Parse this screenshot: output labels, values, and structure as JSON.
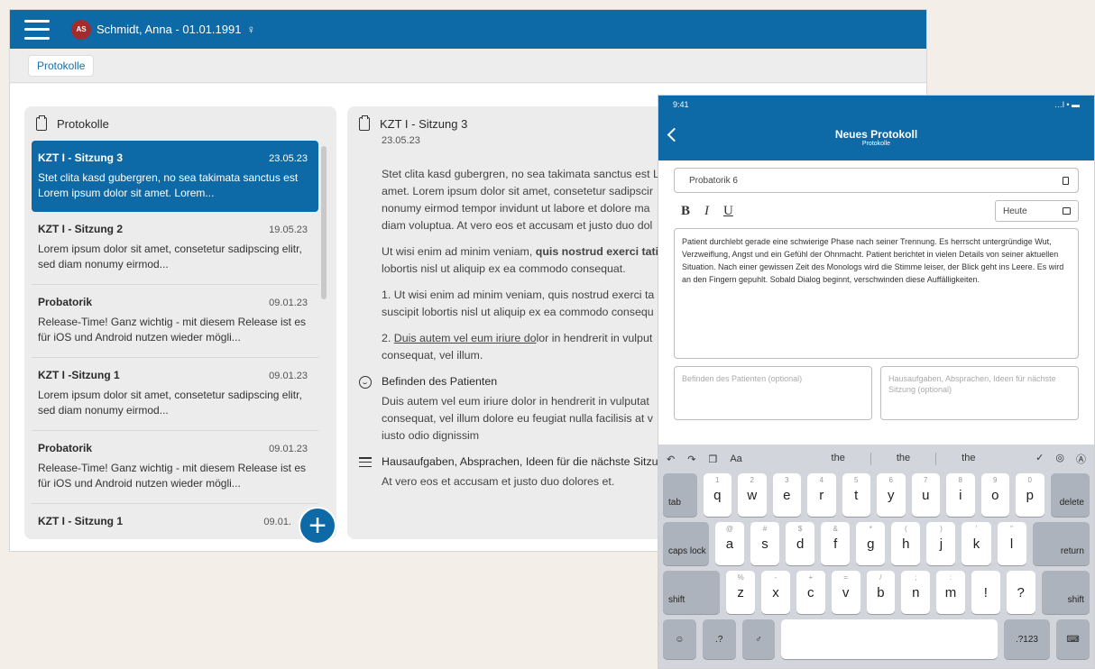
{
  "header": {
    "avatar_initials": "AS",
    "patient": "Schmidt, Anna - 01.01.1991",
    "gender_symbol": "♀"
  },
  "breadcrumb": {
    "chip": "Protokolle"
  },
  "list_panel": {
    "title": "Protokolle",
    "items": [
      {
        "title": "KZT I - Sitzung 3",
        "date": "23.05.23",
        "text": "Stet clita kasd gubergren, no sea takimata sanctus est Lorem ipsum dolor sit amet. Lorem...",
        "active": true
      },
      {
        "title": "KZT I - Sitzung 2",
        "date": "19.05.23",
        "text": "Lorem ipsum dolor sit amet, consetetur sadipscing elitr, sed diam nonumy eirmod..."
      },
      {
        "title": "Probatorik",
        "date": "09.01.23",
        "text": "Release-Time! Ganz wichtig - mit diesem Release ist es für iOS und Android nutzen wieder mögli..."
      },
      {
        "title": "KZT I -Sitzung 1",
        "date": "09.01.23",
        "text": "Lorem ipsum dolor sit amet, consetetur sadipscing elitr, sed diam nonumy eirmod..."
      },
      {
        "title": "Probatorik",
        "date": "09.01.23",
        "text": "Release-Time! Ganz wichtig - mit diesem Release ist es für iOS und Android nutzen wieder mögli..."
      },
      {
        "title": "KZT I - Sitzung 1",
        "date": "09.01.",
        "text": ""
      }
    ],
    "fab_label": "+"
  },
  "detail": {
    "title": "KZT I - Sitzung 3",
    "date": "23.05.23",
    "para1": [
      "Stet clita kasd gubergren, no sea takimata sanctus est L",
      "amet. Lorem ipsum dolor sit amet, consetetur sadipscir",
      "nonumy eirmod tempor invidunt ut labore et dolore ma",
      "diam voluptua. At vero eos et accusam et justo duo dol"
    ],
    "para2_a": "Ut wisi enim ad minim veniam, ",
    "para2_bold": "quis nostrud exerci tatio",
    "para2_b": "lobortis nisl ut aliquip ex ea commodo consequat.",
    "para3": [
      "1. Ut wisi enim ad minim veniam, quis nostrud exerci ta",
      "suscipit lobortis nisl ut aliquip ex ea commodo consequ"
    ],
    "para4_prefix": "2. ",
    "para4_link": "Duis autem vel eum iriure do",
    "para4_a": "lor in hendrerit in vulput",
    "para4_b": "consequat, vel illum.",
    "section1_title": "Befinden des Patienten",
    "section1_text": [
      "Duis autem vel eum iriure dolor in hendrerit in vulputat",
      "consequat, vel illum dolore eu feugiat nulla facilisis at v",
      "iusto odio dignissim"
    ],
    "section2_title": "Hausaufgaben, Absprachen, Ideen für die nächste Sitzu",
    "section2_text": "At vero eos et accusam et justo duo dolores et."
  },
  "tablet": {
    "time": "9:41",
    "status_icons": "…l • ▬",
    "nav_title": "Neues Protokoll",
    "nav_subtitle": "Protokolle",
    "title_input": "Probatorik 6",
    "fmt_bold": "B",
    "fmt_italic": "I",
    "fmt_underline": "U",
    "date_select": "Heute",
    "note": "Patient durchlebt gerade eine schwierige Phase nach seiner Trennung. Es herrscht untergründige Wut, Verzweiflung, Angst und ein Gefühl der Ohnmacht. Patient berichtet in vielen Details von seiner aktuellen Situation. Nach einer gewissen Zeit des Monologs wird die Stimme leiser, der Blick geht ins Leere. Es wird an den Fingern gepuhlt. Sobald Dialog beginnt, verschwinden diese Auffälligkeiten.",
    "field_condition_placeholder": "Befinden des Patienten (optional)",
    "field_homework_placeholder": "Hausaufgaben, Absprachen, Ideen für nächste Sitzung (optional)"
  },
  "keyboard": {
    "predict_left": [
      "↶",
      "↷",
      "❐",
      "Aa"
    ],
    "predictions": [
      "the",
      "the",
      "the"
    ],
    "predict_right": [
      "✓",
      "◎",
      "Ⓐ"
    ],
    "row1": [
      [
        "q",
        "1"
      ],
      [
        "w",
        "2"
      ],
      [
        "e",
        "3"
      ],
      [
        "r",
        "4"
      ],
      [
        "t",
        "5"
      ],
      [
        "y",
        "6"
      ],
      [
        "u",
        "7"
      ],
      [
        "i",
        "8"
      ],
      [
        "o",
        "9"
      ],
      [
        "p",
        "0"
      ]
    ],
    "row2": [
      [
        "a",
        "@"
      ],
      [
        "s",
        "#"
      ],
      [
        "d",
        "$"
      ],
      [
        "f",
        "&"
      ],
      [
        "g",
        "*"
      ],
      [
        "h",
        "("
      ],
      [
        "j",
        ")"
      ],
      [
        "k",
        "'"
      ],
      [
        "l",
        "\""
      ]
    ],
    "row3": [
      [
        "z",
        "%"
      ],
      [
        "x",
        "-"
      ],
      [
        "c",
        "+"
      ],
      [
        "v",
        "="
      ],
      [
        "b",
        "/"
      ],
      [
        "n",
        ";"
      ],
      [
        "m",
        ":"
      ],
      [
        "!",
        ""
      ],
      [
        "?",
        ""
      ]
    ],
    "tab": "tab",
    "delete": "delete",
    "caps": "caps lock",
    "return": "return",
    "shift": "shift",
    "emoji": "☺",
    "num_left": ".?",
    "mic": "♂",
    "num_right": ".?123",
    "hide": "⌨"
  }
}
